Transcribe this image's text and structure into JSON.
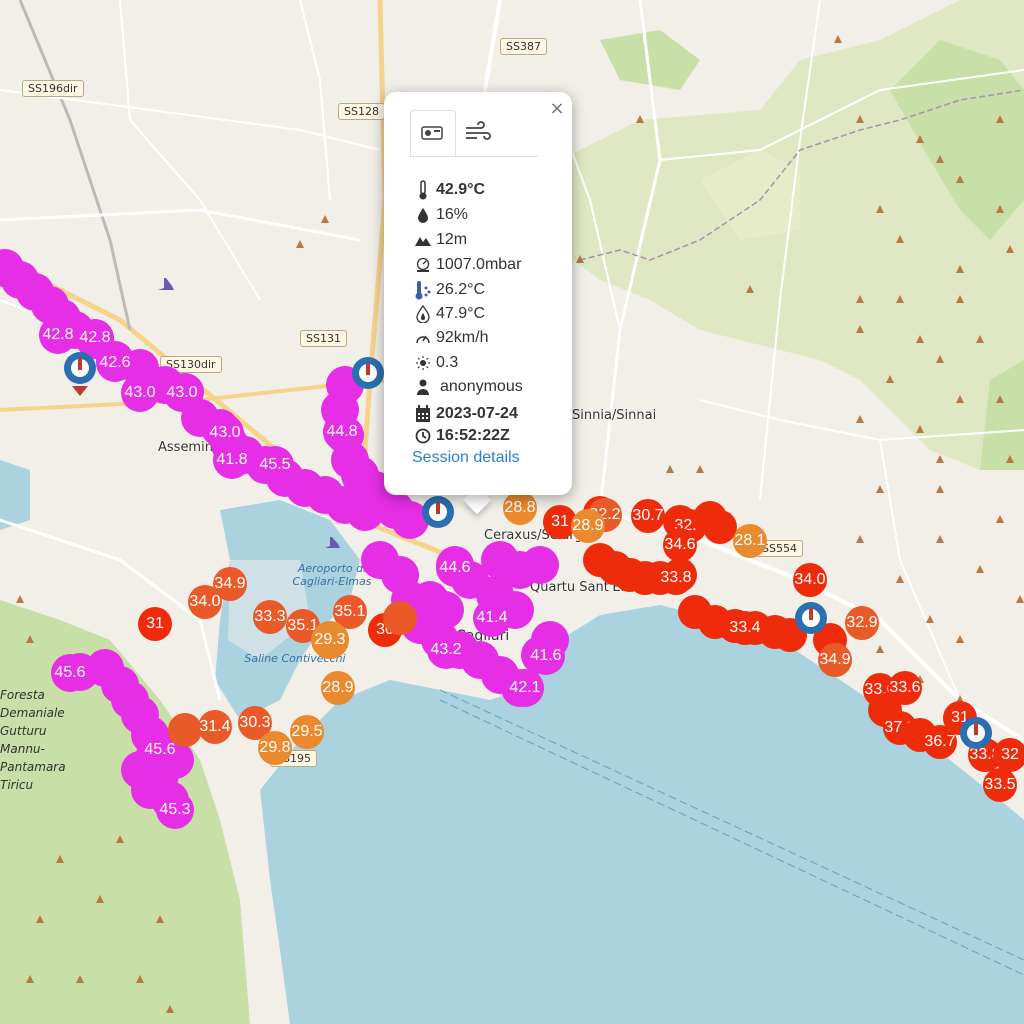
{
  "map": {
    "colors": {
      "land": "#f2efe9",
      "sea": "#aad3df",
      "park": "#c8dfa8",
      "park_light": "#dfe8c2",
      "road": "#ffffff",
      "road_major": "#f7d38a",
      "magenta": "#e62ee6",
      "red": "#ee2c0c",
      "orange_red": "#ea5a28",
      "orange": "#e98a2e"
    },
    "road_labels": [
      "SS387",
      "SS196dir",
      "SS128",
      "SS131",
      "SS130dir",
      "SS554",
      "SS195"
    ],
    "place_labels": [
      "Assemini",
      "Sinnia/Sinnai",
      "Ceraxus/Selargius",
      "Quartu Sant'Elena",
      "Cagliari"
    ],
    "water_labels": [
      "Aeroporto di Cagliari-Elmas",
      "Saline Contivecchi"
    ],
    "park_label": [
      "Foresta",
      "Demaniale",
      "Gutturu",
      "Mannu-",
      "Pantamara",
      "Tiricu"
    ]
  },
  "markers": {
    "magenta": [
      "42.8",
      "42.8",
      "42.6",
      "43.0",
      "43.0",
      "41.8",
      "45.5",
      "44.8",
      "44.6",
      "41.4",
      "41.6",
      "42.1",
      "43.2",
      "45.6",
      "45.3",
      "45.6"
    ],
    "red": [
      "31",
      "30",
      "33.8",
      "34.0",
      "33.4",
      "37.9",
      "36.7",
      "33.8",
      "33.5",
      "32",
      "31"
    ],
    "orange_red": [
      "34.9",
      "34.0",
      "33.3",
      "36.7",
      "35.1",
      "31.4",
      "30.3",
      "34.6",
      "30.7",
      "32.9",
      "32.5",
      "34.9",
      "33.6",
      "32.2"
    ],
    "orange": [
      "29.3",
      "29.8",
      "29.8",
      "29.5",
      "28.9",
      "28.1",
      "28.8"
    ]
  },
  "popup": {
    "tabs": [
      "thermometer-station-icon",
      "wind-icon"
    ],
    "temperature": "42.9°C",
    "humidity": "16%",
    "altitude": "12m",
    "pressure": "1007.0mbar",
    "dew_point": "26.2°C",
    "heat_index": "47.9°C",
    "wind_speed": "92km/h",
    "uv_index": "0.3",
    "user": "anonymous",
    "date": "2023-07-24",
    "time": "16:52:22Z",
    "link": "Session details",
    "close": "×"
  }
}
